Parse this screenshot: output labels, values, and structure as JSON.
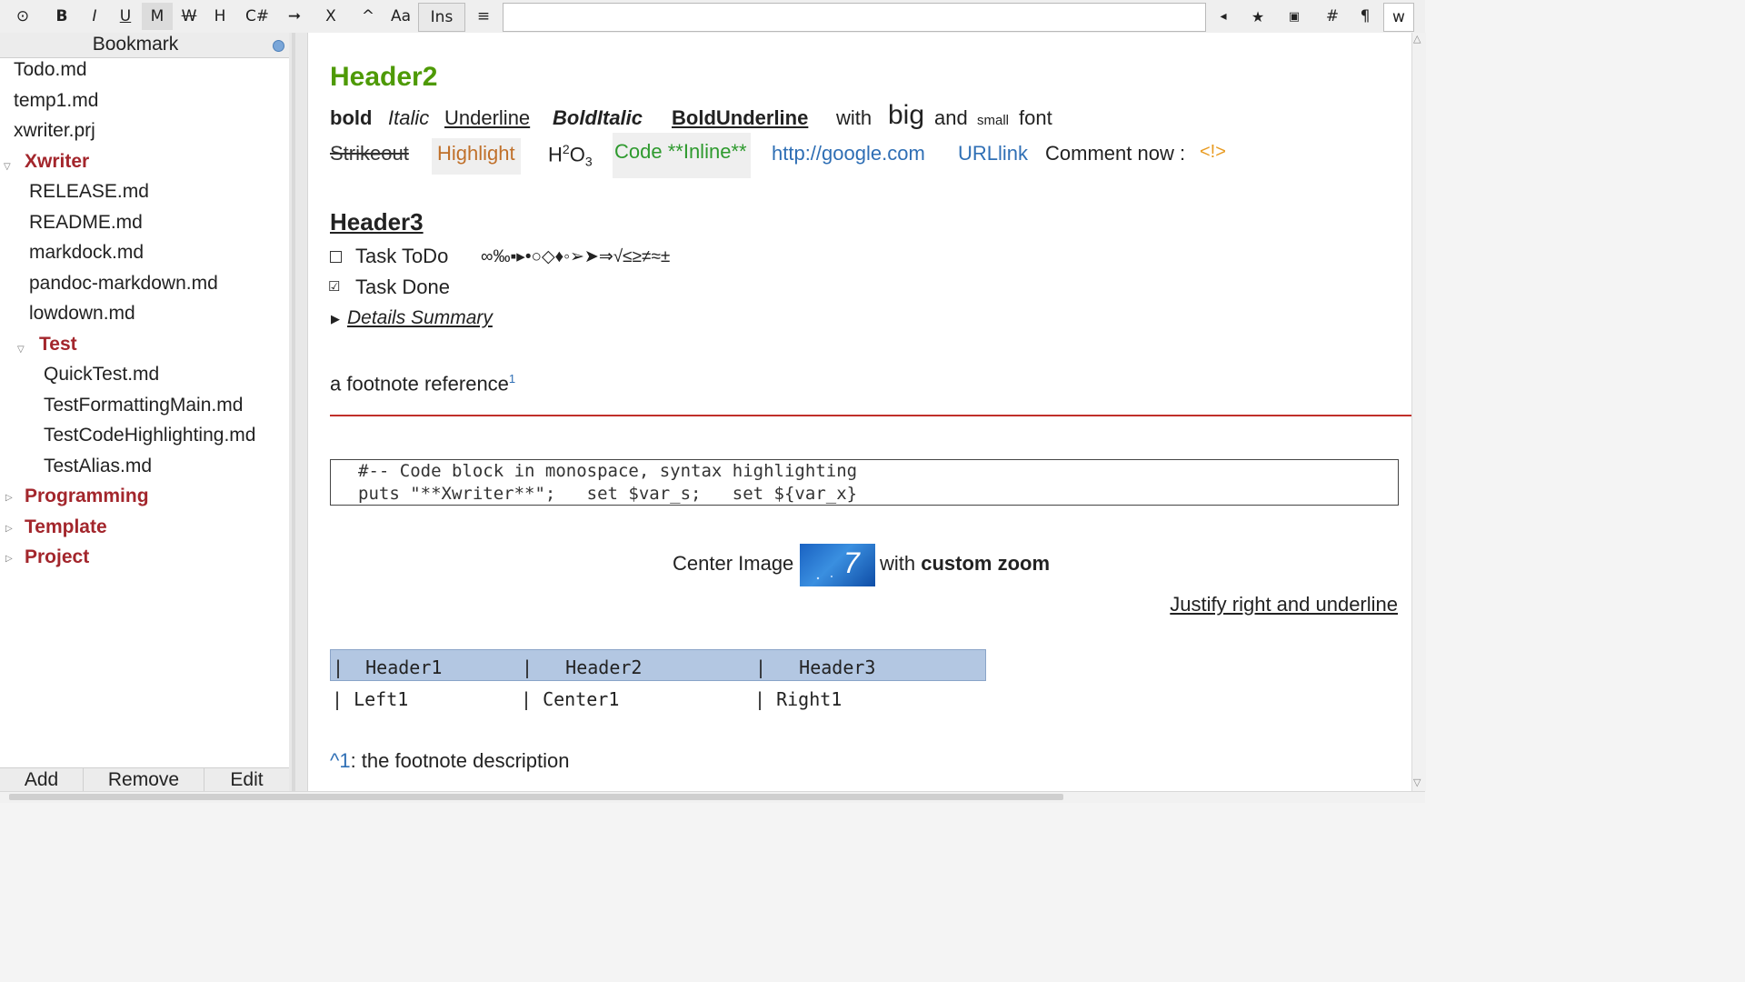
{
  "toolbar": {
    "buttons": [
      "⊙",
      "B",
      "I",
      "U",
      "M",
      "W",
      "H",
      "C#",
      "➞",
      "X",
      "^",
      "Aa",
      "Ins",
      "≡"
    ],
    "search_value": "",
    "right_buttons": [
      "◂",
      "★",
      "▣",
      "#",
      "¶",
      "w"
    ]
  },
  "sidebar": {
    "title": "Bookmark",
    "items": [
      {
        "label": "Todo.md"
      },
      {
        "label": "temp1.md"
      },
      {
        "label": "xwriter.prj"
      },
      {
        "label": "Xwriter"
      },
      {
        "label": "RELEASE.md"
      },
      {
        "label": "README.md"
      },
      {
        "label": "markdock.md"
      },
      {
        "label": "pandoc-markdown.md"
      },
      {
        "label": "lowdown.md"
      },
      {
        "label": "Test"
      },
      {
        "label": "QuickTest.md"
      },
      {
        "label": "TestFormattingMain.md"
      },
      {
        "label": "TestCodeHighlighting.md"
      },
      {
        "label": "TestAlias.md"
      },
      {
        "label": "Programming"
      },
      {
        "label": "Template"
      },
      {
        "label": "Project"
      }
    ],
    "buttons": {
      "add": "Add",
      "remove": "Remove",
      "edit": "Edit"
    }
  },
  "doc": {
    "h2": "Header2",
    "bold": "bold",
    "italic": "Italic",
    "underline": "Underline",
    "bolditalic": "BoldItalic",
    "boldunderline": "BoldUnderline",
    "with": "with",
    "big": "big",
    "and": "and",
    "small": "small",
    "font": "font",
    "strikeout": "Strikeout",
    "highlight": "Highlight",
    "h2o3_h": "H",
    "h2o3_sup": "2",
    "h2o3_o": "O",
    "h2o3_sub": "3",
    "code_inline": "Code **Inline**",
    "link1": "http://google.com",
    "link2": "URLlink",
    "comment": "Comment now :",
    "comment_mark": "<!>",
    "h3": "Header3",
    "task_todo": "Task ToDo",
    "symbols": "∞‰▪▸•○◇♦◦➢➤⇒√≤≥≠≈±",
    "task_done": "Task Done",
    "details": "Details Summary",
    "footnote_text": "a footnote reference",
    "footnote_ref": "1",
    "code_line1": "#-- Code block in monospace, syntax highlighting",
    "code_line2": "puts \"**Xwriter**\";   set $var_s;   set ${var_x}",
    "center_image": "Center Image",
    "with2": "with",
    "custom_zoom": "custom zoom",
    "justify": "Justify right and underline",
    "table_header": [
      "|  Header1",
      "|   Header2",
      "|   Header3"
    ],
    "table_row": [
      "| Left1",
      "| Center1",
      "| Right1"
    ],
    "fn_caret": "^1",
    "fn_desc": ": the footnote description"
  },
  "colors": {
    "header2": "#4e9a06",
    "folder": "#a3262c",
    "link": "#2f6fb5",
    "highlight_text": "#c0702a",
    "code_inline": "#2e9a2e",
    "rule": "#c0302a",
    "table_header_bg": "#b3c7e2"
  }
}
